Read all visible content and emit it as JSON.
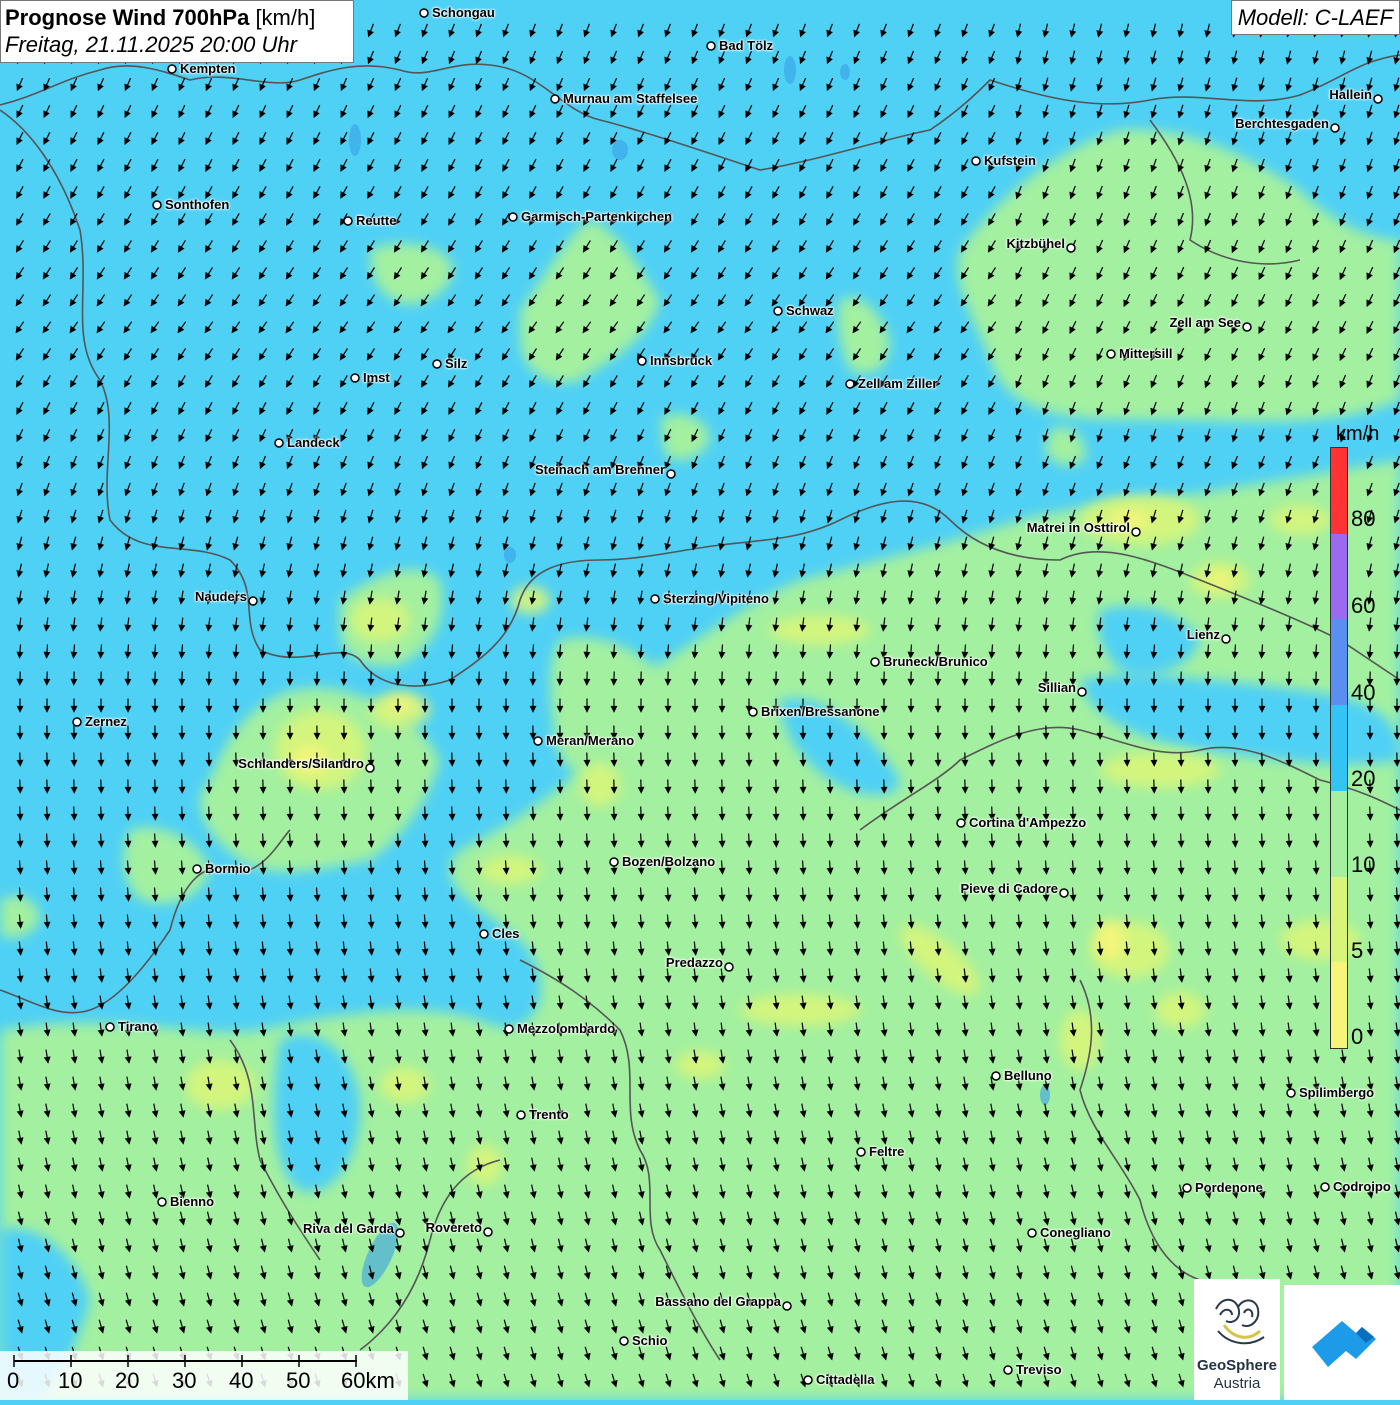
{
  "title": {
    "main": "Prognose Wind 700hPa",
    "unit": "[km/h]",
    "datetime": "Freitag, 21.11.2025 20:00 Uhr"
  },
  "model": "Modell: C-LAEF",
  "colors": {
    "wind_20_40": "#4fd0f5",
    "wind_10_20": "#a3f0a0",
    "wind_5_10": "#d8f57a",
    "wind_0_5": "#f5f57a",
    "border": "#555555",
    "arrow": "#000000"
  },
  "legend": {
    "title": "km/h",
    "labels": [
      "80",
      "60",
      "40",
      "20",
      "10",
      "5",
      "0"
    ],
    "colors": [
      "#ff3333",
      "#9a6bf0",
      "#5a8ef0",
      "#32c4f5",
      "#a3f0a0",
      "#d8f57a",
      "#f5f57a"
    ]
  },
  "cities": [
    {
      "name": "Schongau"
    },
    {
      "name": "Bad Tölz"
    },
    {
      "name": "Kempten"
    },
    {
      "name": "Murnau am Staffelsee"
    },
    {
      "name": "Hallein"
    },
    {
      "name": "Berchtesgaden"
    },
    {
      "name": "Kufstein"
    },
    {
      "name": "Sonthofen"
    },
    {
      "name": "Reutte"
    },
    {
      "name": "Garmisch-Partenkirchen"
    },
    {
      "name": "Kitzbühel"
    },
    {
      "name": "Schwaz"
    },
    {
      "name": "Zell am See"
    },
    {
      "name": "Mittersill"
    },
    {
      "name": "Innsbruck"
    },
    {
      "name": "Silz"
    },
    {
      "name": "Imst"
    },
    {
      "name": "Zell am Ziller"
    },
    {
      "name": "Landeck"
    },
    {
      "name": "Steinach am Brenner"
    },
    {
      "name": "Matrei in Osttirol"
    },
    {
      "name": "Nauders"
    },
    {
      "name": "Sterzing/Vipiteno"
    },
    {
      "name": "Lienz"
    },
    {
      "name": "Bruneck/Brunico"
    },
    {
      "name": "Sillian"
    },
    {
      "name": "Zernez"
    },
    {
      "name": "Brixen/Bressanone"
    },
    {
      "name": "Meran/Merano"
    },
    {
      "name": "Schlanders/Silandro"
    },
    {
      "name": "Cortina d'Ampezzo"
    },
    {
      "name": "Bozen/Bolzano"
    },
    {
      "name": "Bormio"
    },
    {
      "name": "Pieve di Cadore"
    },
    {
      "name": "Cles"
    },
    {
      "name": "Predazzo"
    },
    {
      "name": "Tirano"
    },
    {
      "name": "Mezzolombardo"
    },
    {
      "name": "Belluno"
    },
    {
      "name": "Spilimbergo"
    },
    {
      "name": "Trento"
    },
    {
      "name": "Feltre"
    },
    {
      "name": "Pordenone"
    },
    {
      "name": "Codroipo"
    },
    {
      "name": "Bienno"
    },
    {
      "name": "Riva del Garda"
    },
    {
      "name": "Rovereto"
    },
    {
      "name": "Conegliano"
    },
    {
      "name": "Bassano del Grappa"
    },
    {
      "name": "Schio"
    },
    {
      "name": "Treviso"
    },
    {
      "name": "Cittadella"
    }
  ],
  "scale": {
    "labels": [
      "0",
      "10",
      "20",
      "30",
      "40",
      "50",
      "60km"
    ]
  },
  "logos": {
    "geosphere_line1": "GeoSphere",
    "geosphere_line2": "Austria"
  }
}
